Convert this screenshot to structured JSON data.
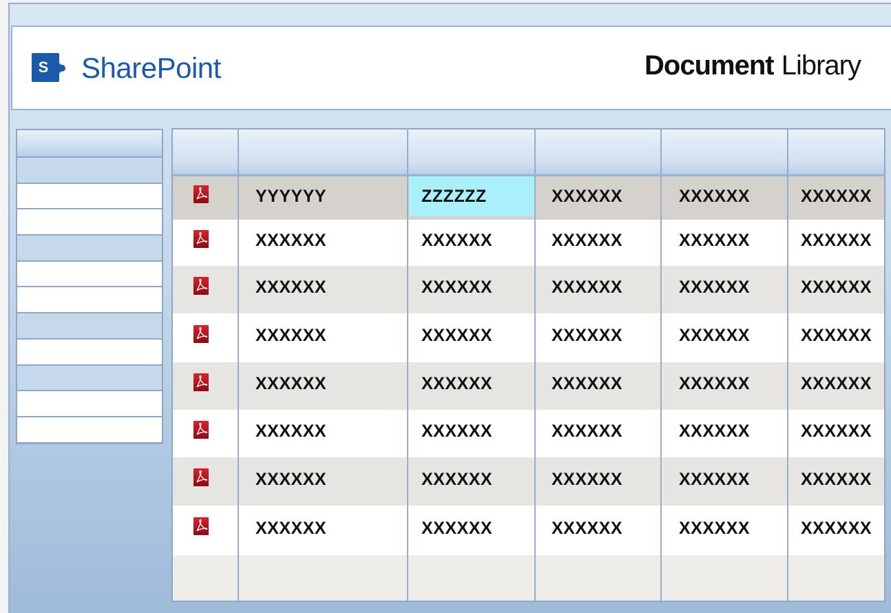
{
  "header": {
    "brand_name": "SharePoint",
    "brand_logo_letter": "S",
    "title_bold": "Document",
    "title_light": "Library"
  },
  "colors": {
    "brand": "#1b5aa8",
    "highlight_cell": "#a9f0fb",
    "pdf_icon": "#b5121b"
  },
  "sidebar": {
    "items": [
      {
        "type": "head"
      },
      {
        "type": "cat"
      },
      {
        "type": "link"
      },
      {
        "type": "link"
      },
      {
        "type": "cat"
      },
      {
        "type": "link"
      },
      {
        "type": "link"
      },
      {
        "type": "cat"
      },
      {
        "type": "link"
      },
      {
        "type": "cat"
      },
      {
        "type": "link"
      },
      {
        "type": "link"
      }
    ]
  },
  "grid": {
    "columns": [
      "",
      "",
      "",
      "",
      "",
      ""
    ],
    "rows": [
      {
        "icon": "pdf-icon",
        "cells": [
          "YYYYYY",
          "ZZZZZZ",
          "XXXXXX",
          "XXXXXX",
          "XXXXXX"
        ],
        "selected": true,
        "highlight_col": 1
      },
      {
        "icon": "pdf-icon",
        "cells": [
          "XXXXXX",
          "XXXXXX",
          "XXXXXX",
          "XXXXXX",
          "XXXXXX"
        ]
      },
      {
        "icon": "pdf-icon",
        "cells": [
          "XXXXXX",
          "XXXXXX",
          "XXXXXX",
          "XXXXXX",
          "XXXXXX"
        ]
      },
      {
        "icon": "pdf-icon",
        "cells": [
          "XXXXXX",
          "XXXXXX",
          "XXXXXX",
          "XXXXXX",
          "XXXXXX"
        ]
      },
      {
        "icon": "pdf-icon",
        "cells": [
          "XXXXXX",
          "XXXXXX",
          "XXXXXX",
          "XXXXXX",
          "XXXXXX"
        ]
      },
      {
        "icon": "pdf-icon",
        "cells": [
          "XXXXXX",
          "XXXXXX",
          "XXXXXX",
          "XXXXXX",
          "XXXXXX"
        ]
      },
      {
        "icon": "pdf-icon",
        "cells": [
          "XXXXXX",
          "XXXXXX",
          "XXXXXX",
          "XXXXXX",
          "XXXXXX"
        ]
      },
      {
        "icon": "pdf-icon",
        "cells": [
          "XXXXXX",
          "XXXXXX",
          "XXXXXX",
          "XXXXXX",
          "XXXXXX"
        ]
      }
    ]
  }
}
